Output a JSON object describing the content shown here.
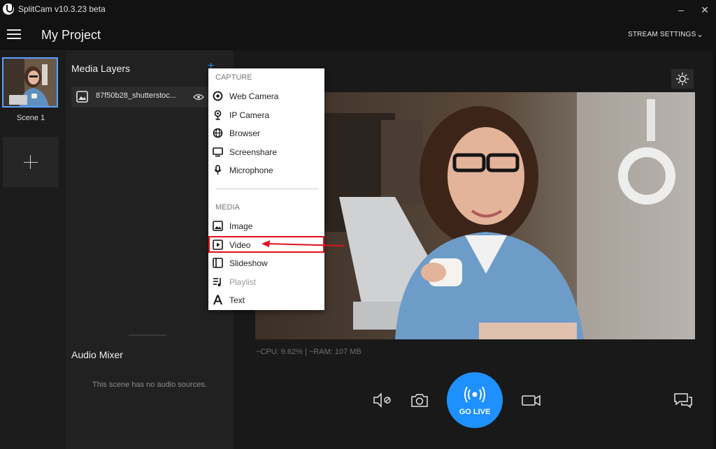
{
  "window": {
    "app_title": "SplitCam v10.3.23 beta",
    "minimize": "–",
    "close": "✕"
  },
  "header": {
    "project_title": "My Project",
    "stream_settings": "STREAM SETTINGS",
    "chevron": "⌄"
  },
  "scenes": {
    "items": [
      {
        "label": "Scene 1"
      }
    ],
    "add_label": "+"
  },
  "layers": {
    "title": "Media Layers",
    "items": [
      {
        "name": "87f50b28_shutterstoc..."
      }
    ]
  },
  "audio": {
    "title": "Audio Mixer",
    "empty_message": "This scene has no audio sources."
  },
  "stats": {
    "text": "~CPU: 9.62% | ~RAM: 107 MB"
  },
  "controls": {
    "go_live": "GO LIVE"
  },
  "add_menu": {
    "capture_header": "CAPTURE",
    "capture_items": [
      {
        "label": "Web Camera",
        "icon": "webcam-icon"
      },
      {
        "label": "IP Camera",
        "icon": "ip-camera-icon"
      },
      {
        "label": "Browser",
        "icon": "globe-icon"
      },
      {
        "label": "Screenshare",
        "icon": "screenshare-icon"
      },
      {
        "label": "Microphone",
        "icon": "microphone-icon"
      }
    ],
    "media_header": "MEDIA",
    "media_items": [
      {
        "label": "Image",
        "icon": "image-icon"
      },
      {
        "label": "Video",
        "icon": "video-icon"
      },
      {
        "label": "Slideshow",
        "icon": "slideshow-icon"
      },
      {
        "label": "Playlist",
        "icon": "playlist-icon",
        "disabled": true
      },
      {
        "label": "Text",
        "icon": "text-icon"
      }
    ]
  },
  "colors": {
    "accent": "#1e90ff",
    "highlight": "#e0101c",
    "background": "#1e1e1e"
  }
}
